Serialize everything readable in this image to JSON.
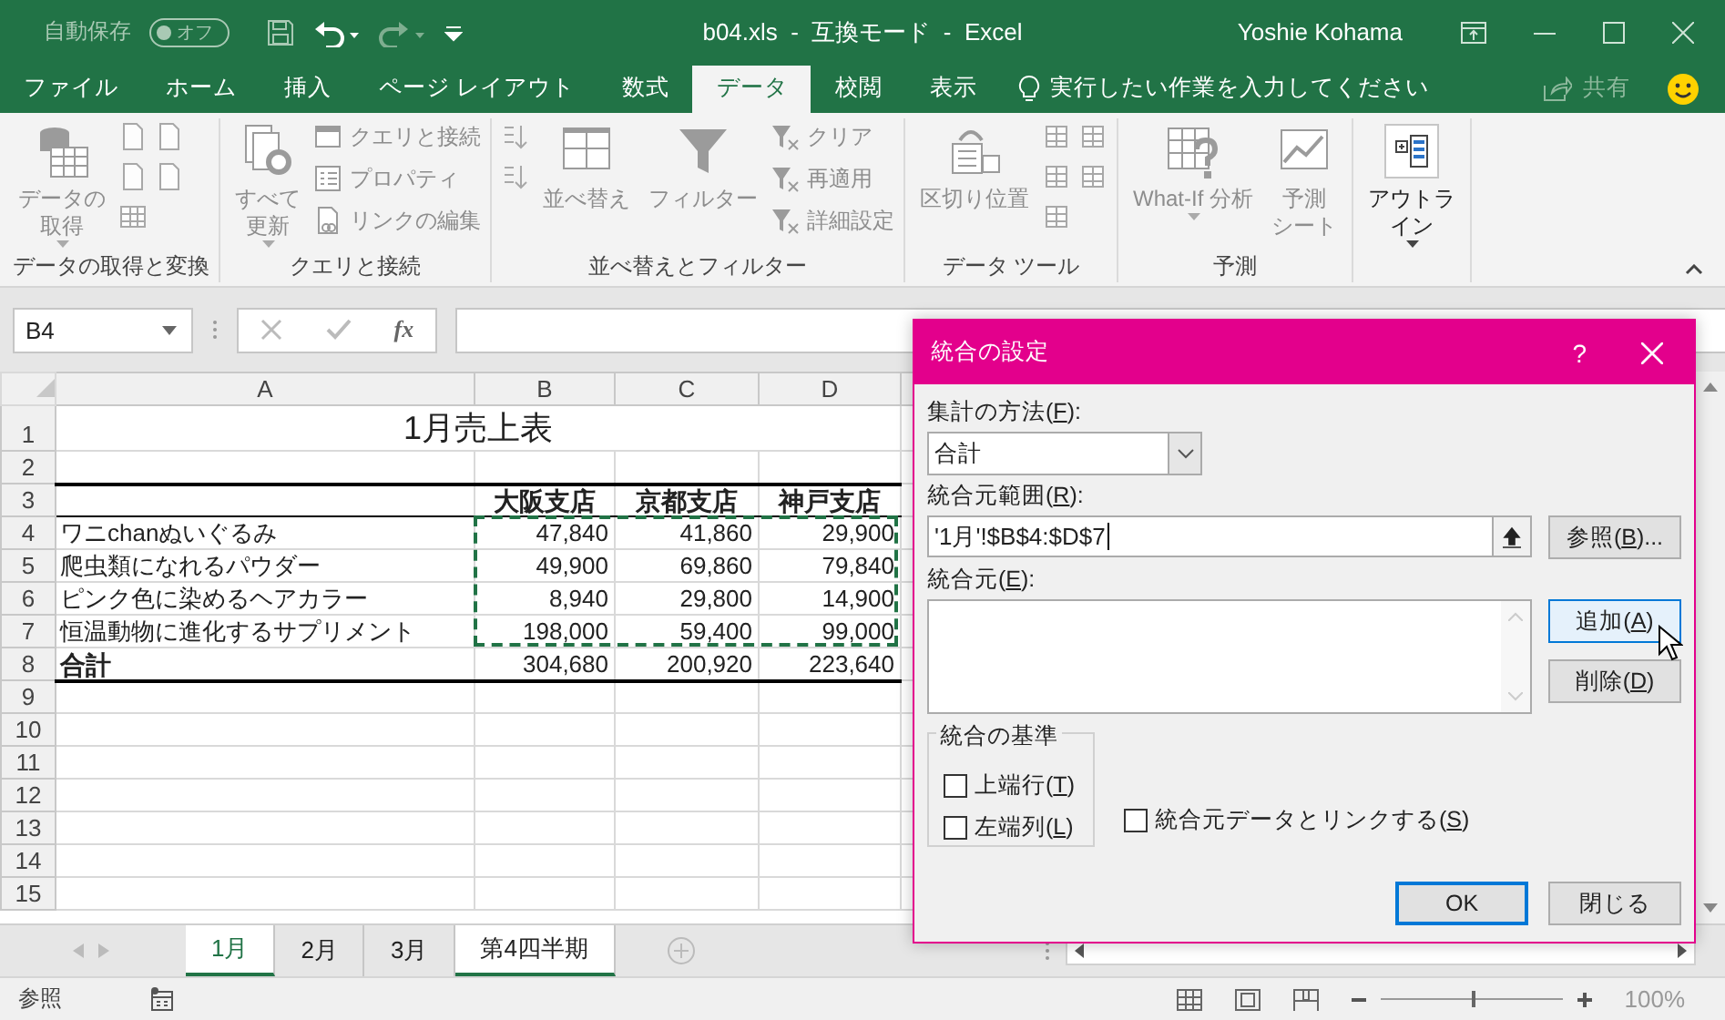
{
  "window": {
    "title": "b04.xls  -  互換モード  -  Excel",
    "user": "Yoshie Kohama"
  },
  "quick_access": {
    "autosave_label": "自動保存",
    "autosave_state": "オフ",
    "autosave_on": false
  },
  "ribbon_tabs": [
    {
      "label": "ファイル",
      "selected": false
    },
    {
      "label": "ホーム",
      "selected": false
    },
    {
      "label": "挿入",
      "selected": false
    },
    {
      "label": "ページ レイアウト",
      "selected": false
    },
    {
      "label": "数式",
      "selected": false
    },
    {
      "label": "データ",
      "selected": true
    },
    {
      "label": "校閲",
      "selected": false
    },
    {
      "label": "表示",
      "selected": false
    }
  ],
  "tell_me": "実行したい作業を入力してください",
  "share": "共有",
  "ribbon_groups": [
    {
      "label": "データの取得と変換",
      "items": [
        {
          "kind": "large",
          "lines": [
            "データの",
            "取得"
          ],
          "caret": true,
          "disabled": true
        },
        {
          "kind": "stack",
          "entries": [
            {
              "disabled": true
            },
            {
              "disabled": true
            },
            {
              "disabled": true
            }
          ]
        },
        {
          "kind": "stack",
          "entries": [
            {
              "disabled": true
            },
            {
              "disabled": true
            }
          ]
        }
      ]
    },
    {
      "label": "クエリと接続",
      "items": [
        {
          "kind": "large",
          "lines": [
            "すべて",
            "更新"
          ],
          "caret": true,
          "disabled": true
        },
        {
          "kind": "stack",
          "entries": [
            {
              "label": "クエリと接続",
              "disabled": true
            },
            {
              "label": "プロパティ",
              "disabled": true
            },
            {
              "label": "リンクの編集",
              "disabled": true
            }
          ]
        }
      ]
    },
    {
      "label": "並べ替えとフィルター",
      "items": [
        {
          "kind": "stack",
          "entries": [
            {
              "disabled": true
            },
            {
              "disabled": true
            }
          ]
        },
        {
          "kind": "large",
          "lines": [
            "並べ替え"
          ],
          "caret": false,
          "disabled": true
        },
        {
          "kind": "large",
          "lines": [
            "フィルター"
          ],
          "caret": false,
          "disabled": true
        },
        {
          "kind": "stack",
          "entries": [
            {
              "label": "クリア",
              "disabled": true
            },
            {
              "label": "再適用",
              "disabled": true
            },
            {
              "label": "詳細設定",
              "disabled": true
            }
          ]
        }
      ]
    },
    {
      "label": "データ ツール",
      "items": [
        {
          "kind": "large",
          "lines": [
            "区切り位置"
          ],
          "caret": false,
          "disabled": true
        },
        {
          "kind": "stack",
          "entries": [
            {
              "disabled": true
            },
            {
              "disabled": true
            },
            {
              "disabled": true
            }
          ]
        },
        {
          "kind": "stack",
          "entries": [
            {
              "disabled": true
            },
            {
              "disabled": true
            }
          ]
        }
      ]
    },
    {
      "label": "予測",
      "items": [
        {
          "kind": "large",
          "lines": [
            "What-If 分析"
          ],
          "caret": true,
          "disabled": true
        },
        {
          "kind": "large",
          "lines": [
            "予測",
            "シート"
          ],
          "caret": false,
          "disabled": true
        }
      ]
    },
    {
      "items": [
        {
          "kind": "large",
          "lines": [
            "アウトラ",
            "イン"
          ],
          "caret": true,
          "disabled": false
        }
      ]
    }
  ],
  "formula_bar": {
    "name_box": "B4",
    "function_label": "fx"
  },
  "sheet": {
    "columns": [
      "A",
      "B",
      "C",
      "D"
    ],
    "rows": [
      {
        "number": "1",
        "kind": "title",
        "title": "1月売上表"
      },
      {
        "number": "2",
        "kind": "empty"
      },
      {
        "number": "3",
        "kind": "header",
        "headers": [
          "大阪支店",
          "京都支店",
          "神戸支店"
        ]
      },
      {
        "number": "4",
        "kind": "item",
        "label": "ワニchanぬいぐるみ",
        "values": [
          "47,840",
          "41,860",
          "29,900"
        ],
        "in_range": true
      },
      {
        "number": "5",
        "kind": "item",
        "label": "爬虫類になれるパウダー",
        "values": [
          "49,900",
          "69,860",
          "79,840"
        ],
        "in_range": true
      },
      {
        "number": "6",
        "kind": "item",
        "label": "ピンク色に染めるヘアカラー",
        "values": [
          "8,940",
          "29,800",
          "14,900"
        ],
        "in_range": true
      },
      {
        "number": "7",
        "kind": "item",
        "label": "恒温動物に進化するサプリメント",
        "values": [
          "198,000",
          "59,400",
          "99,000"
        ],
        "in_range": true
      },
      {
        "number": "8",
        "kind": "total",
        "label": "合計",
        "values": [
          "304,680",
          "200,920",
          "223,640"
        ]
      },
      {
        "number": "9",
        "kind": "empty"
      },
      {
        "number": "10",
        "kind": "empty"
      },
      {
        "number": "11",
        "kind": "empty"
      },
      {
        "number": "12",
        "kind": "empty"
      },
      {
        "number": "13",
        "kind": "empty"
      },
      {
        "number": "14",
        "kind": "empty"
      },
      {
        "number": "15",
        "kind": "empty"
      }
    ]
  },
  "sheet_tabs": [
    {
      "label": "1月",
      "selected": true,
      "active": true
    },
    {
      "label": "2月",
      "selected": false,
      "active": false
    },
    {
      "label": "3月",
      "selected": false,
      "active": false
    },
    {
      "label": "第4四半期",
      "selected": true,
      "active": false
    }
  ],
  "status_bar": {
    "mode": "参照",
    "zoom": {
      "level": 0.5,
      "reading": "100%"
    }
  },
  "dialog": {
    "title": "統合の設定",
    "help": "?",
    "function_label": {
      "before": "集計の方法(",
      "key": "F",
      "after": "):"
    },
    "function_value": "合計",
    "reference_label": {
      "before": "統合元範囲(",
      "key": "R",
      "after": "):"
    },
    "reference_value": "'1月'!$B$4:$D$7",
    "browse_button": {
      "before": "参照(",
      "key": "B",
      "after": ")..."
    },
    "references_label": {
      "before": "統合元(",
      "key": "E",
      "after": "):"
    },
    "add_button": {
      "before": "追加(",
      "key": "A",
      "after": ")",
      "hovered": true
    },
    "delete_button": {
      "before": "削除(",
      "key": "D",
      "after": ")",
      "hovered": false
    },
    "use_labels": {
      "title": "統合の基準",
      "options": [
        {
          "before": "上端行(",
          "key": "T",
          "after": ")",
          "checked": false
        },
        {
          "before": "左端列(",
          "key": "L",
          "after": ")",
          "checked": false
        }
      ]
    },
    "link_option": {
      "before": "統合元データとリンクする(",
      "key": "S",
      "after": ")",
      "checked": false
    },
    "ok_button": {
      "label": "OK",
      "default": true
    },
    "close_button": {
      "label": "閉じる",
      "default": false
    }
  }
}
